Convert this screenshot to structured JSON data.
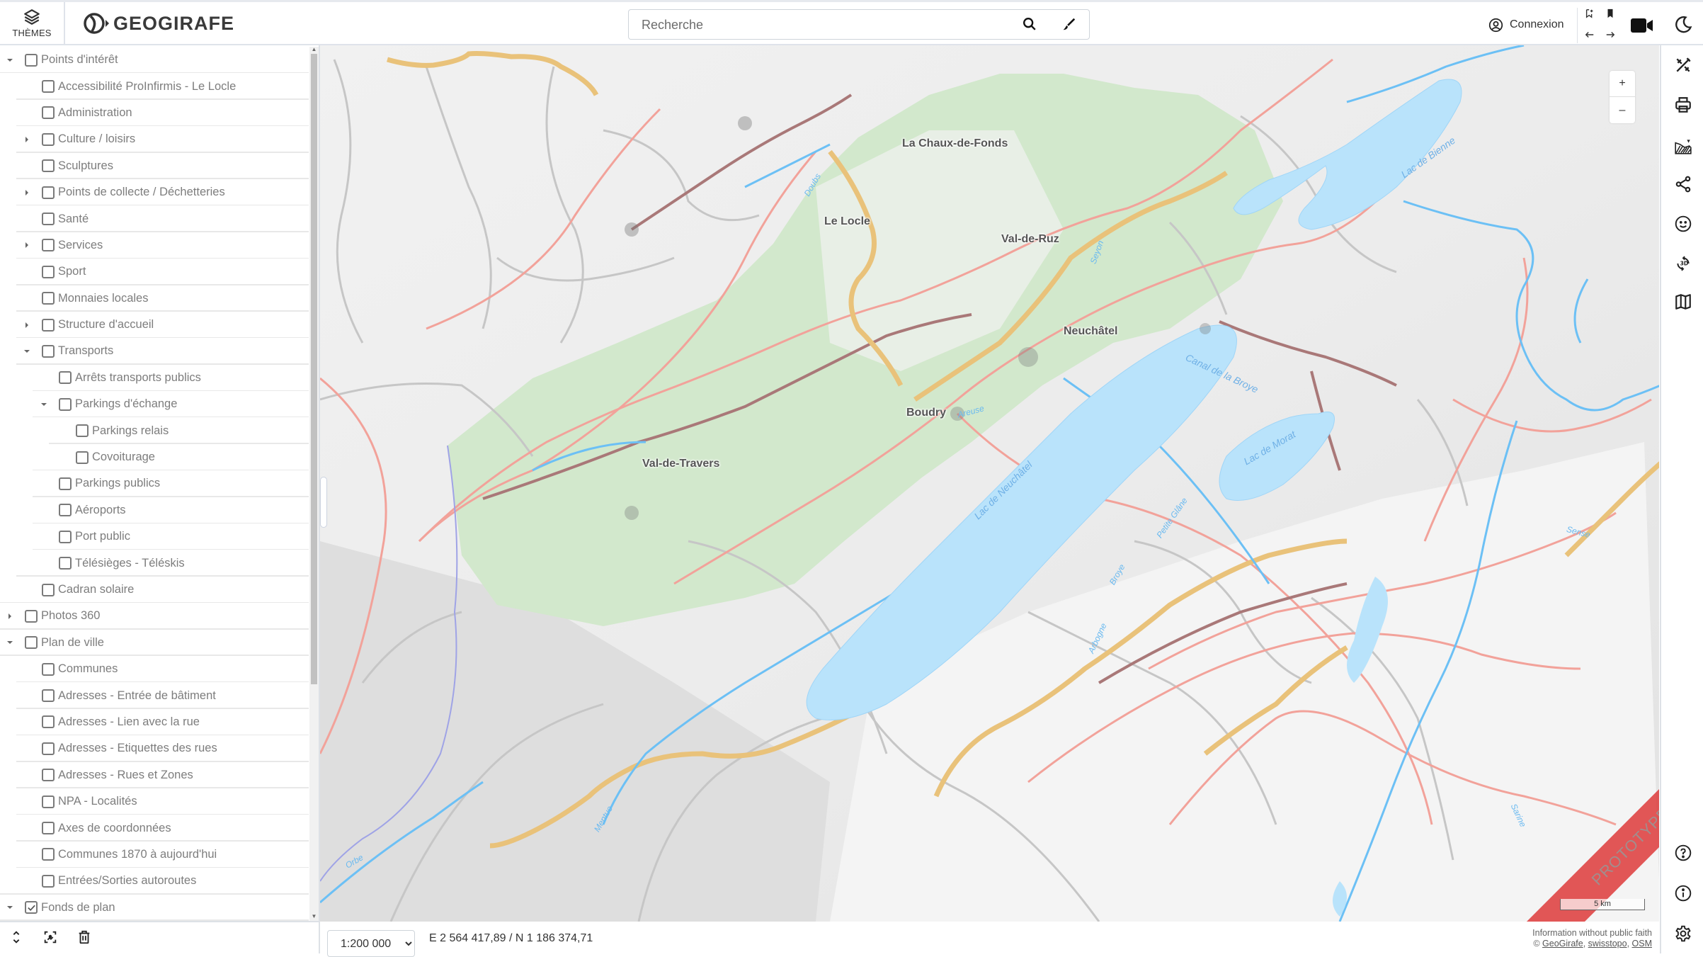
{
  "header": {
    "themes_label": "THÈMES",
    "logo_text": "GEOGIRAFE",
    "search_placeholder": "Recherche",
    "search_value": "",
    "login_label": "Connexion"
  },
  "icons": {
    "themes": "layers-icon",
    "logo": "geogirafe-logo-icon",
    "search": "search-icon",
    "draw": "paintbrush-icon",
    "user": "user-circle-icon",
    "bookmark_add": "bookmark-add-icon",
    "bookmark": "bookmark-icon",
    "back": "arrow-left-icon",
    "forward": "arrow-right-icon",
    "video": "video-camera-icon",
    "dark_mode": "moon-icon"
  },
  "sidebar": {
    "tree": [
      {
        "label": "Points d'intérêt",
        "level": 0,
        "expander": "expanded",
        "checked": false
      },
      {
        "label": "Accessibilité ProInfirmis - Le Locle",
        "level": 1,
        "expander": "none",
        "checked": false
      },
      {
        "label": "Administration",
        "level": 1,
        "expander": "none",
        "checked": false
      },
      {
        "label": "Culture / loisirs",
        "level": 1,
        "expander": "collapsed",
        "checked": false
      },
      {
        "label": "Sculptures",
        "level": 1,
        "expander": "none",
        "checked": false
      },
      {
        "label": "Points de collecte / Déchetteries",
        "level": 1,
        "expander": "collapsed",
        "checked": false
      },
      {
        "label": "Santé",
        "level": 1,
        "expander": "none",
        "checked": false
      },
      {
        "label": "Services",
        "level": 1,
        "expander": "collapsed",
        "checked": false
      },
      {
        "label": "Sport",
        "level": 1,
        "expander": "none",
        "checked": false
      },
      {
        "label": "Monnaies locales",
        "level": 1,
        "expander": "none",
        "checked": false
      },
      {
        "label": "Structure d'accueil",
        "level": 1,
        "expander": "collapsed",
        "checked": false
      },
      {
        "label": "Transports",
        "level": 1,
        "expander": "expanded",
        "checked": false
      },
      {
        "label": "Arrêts transports publics",
        "level": 2,
        "expander": "none",
        "checked": false
      },
      {
        "label": "Parkings d'échange",
        "level": 2,
        "expander": "expanded",
        "checked": false
      },
      {
        "label": "Parkings relais",
        "level": 3,
        "expander": "none",
        "checked": false
      },
      {
        "label": "Covoiturage",
        "level": 3,
        "expander": "none",
        "checked": false
      },
      {
        "label": "Parkings publics",
        "level": 2,
        "expander": "none",
        "checked": false
      },
      {
        "label": "Aéroports",
        "level": 2,
        "expander": "none",
        "checked": false
      },
      {
        "label": "Port public",
        "level": 2,
        "expander": "none",
        "checked": false
      },
      {
        "label": "Télésièges - Téléskis",
        "level": 2,
        "expander": "none",
        "checked": false
      },
      {
        "label": "Cadran solaire",
        "level": 1,
        "expander": "none",
        "checked": false
      },
      {
        "label": "Photos 360",
        "level": 0,
        "expander": "collapsed",
        "checked": false
      },
      {
        "label": "Plan de ville",
        "level": 0,
        "expander": "expanded",
        "checked": false
      },
      {
        "label": "Communes",
        "level": 1,
        "expander": "none",
        "checked": false
      },
      {
        "label": "Adresses - Entrée de bâtiment",
        "level": 1,
        "expander": "none",
        "checked": false
      },
      {
        "label": "Adresses - Lien avec la rue",
        "level": 1,
        "expander": "none",
        "checked": false
      },
      {
        "label": "Adresses - Etiquettes des rues",
        "level": 1,
        "expander": "none",
        "checked": false
      },
      {
        "label": "Adresses - Rues et Zones",
        "level": 1,
        "expander": "none",
        "checked": false
      },
      {
        "label": "NPA - Localités",
        "level": 1,
        "expander": "none",
        "checked": false
      },
      {
        "label": "Axes de coordonnées",
        "level": 1,
        "expander": "none",
        "checked": false
      },
      {
        "label": "Communes 1870 à aujourd'hui",
        "level": 1,
        "expander": "none",
        "checked": false
      },
      {
        "label": "Entrées/Sorties autoroutes",
        "level": 1,
        "expander": "none",
        "checked": false
      },
      {
        "label": "Fonds de plan",
        "level": 0,
        "expander": "expanded",
        "checked": true
      }
    ],
    "footer_icons": [
      "expand-collapse-icon",
      "zoom-to-extent-icon",
      "trash-icon"
    ]
  },
  "map": {
    "zoom_in_label": "+",
    "zoom_out_label": "–",
    "labels": {
      "chaux_de_fonds": "La Chaux-de-Fonds",
      "le_locle": "Le Locle",
      "val_de_ruz": "Val-de-Ruz",
      "neuchatel": "Neuchâtel",
      "boudry": "Boudry",
      "val_de_travers": "Val-de-Travers",
      "lac_neuchatel": "Lac de Neuchâtel",
      "lac_bienne": "Lac de Bienne",
      "lac_morat": "Lac de Morat",
      "canal_broye": "Canal de la Broye",
      "doubs": "Doubs",
      "areuse": "Areuse",
      "seyon": "Seyon",
      "orbe": "Orbe",
      "mentue": "Mentue",
      "petite_glane": "Petite Glâne",
      "broye": "Broye",
      "arbogne": "Arbogne",
      "sense": "Sense",
      "sarine": "Sarine"
    },
    "scale_bar_label": "5 km",
    "watermark": "PROTOTYPE",
    "colors": {
      "lake": "#b9e3fb",
      "river": "#6cc0f5",
      "forest": "#cfe6c9",
      "main_road": "#f2a59d",
      "highway": "#e9c27a",
      "minor_road": "#c8c8c8",
      "railway": "#a97b7b",
      "prototype_band": "#dd3333"
    }
  },
  "bottombar": {
    "scale_options": [
      "1:200 000"
    ],
    "scale_selected": "1:200 000",
    "coordinates": "E 2 564 417,89 / N 1 186 374,71",
    "attribution_line1": "Information without public faith",
    "attribution_prefix": "© ",
    "attribution_links": [
      "GeoGirafe",
      "swisstopo",
      "OSM"
    ]
  },
  "right_toolbar": {
    "top": [
      "drawing-tools-icon",
      "print-icon",
      "elevation-profile-icon",
      "share-icon",
      "feedback-smiley-icon",
      "3d-rotate-icon",
      "map-icon"
    ],
    "bottom": [
      "help-icon",
      "info-icon",
      "settings-icon"
    ]
  }
}
